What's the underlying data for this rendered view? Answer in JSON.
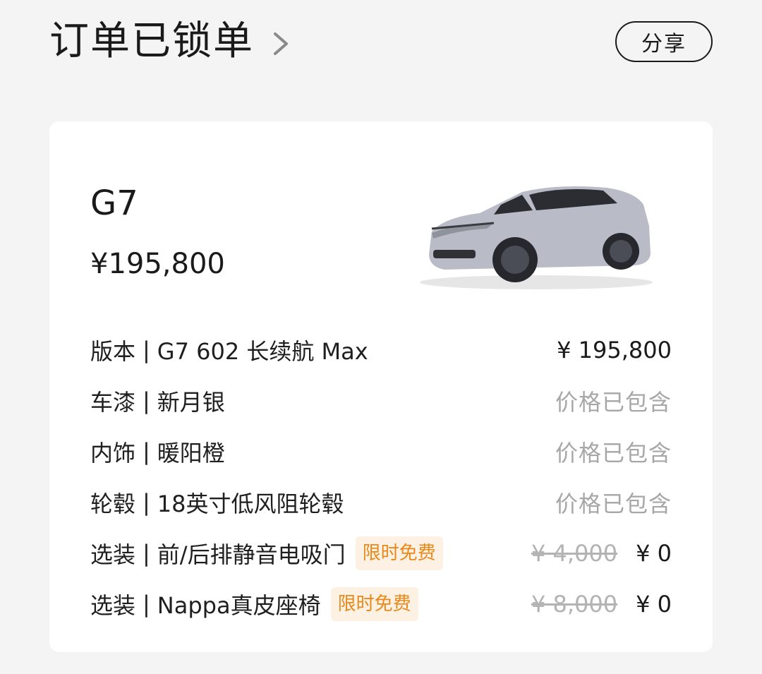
{
  "header": {
    "title": "订单已锁单",
    "share_label": "分享"
  },
  "card": {
    "model": "G7",
    "price": "¥195,800",
    "rows": [
      {
        "label": "版本",
        "sep": "|",
        "value": "G7 602 长续航 Max",
        "price": "¥ 195,800"
      },
      {
        "label": "车漆",
        "sep": "|",
        "value": "新月银",
        "included": "价格已包含"
      },
      {
        "label": "内饰",
        "sep": "|",
        "value": "暖阳橙",
        "included": "价格已包含"
      },
      {
        "label": "轮毂",
        "sep": "|",
        "value": "18英寸低风阻轮毂",
        "included": "价格已包含"
      },
      {
        "label": "选装",
        "sep": "|",
        "value": "前/后排静音电吸门",
        "badge": "限时免费",
        "old_price": "¥ 4,000",
        "price": "¥ 0"
      },
      {
        "label": "选装",
        "sep": "|",
        "value": "Nappa真皮座椅",
        "badge": "限时免费",
        "old_price": "¥ 8,000",
        "price": "¥ 0"
      }
    ]
  },
  "colors": {
    "background": "#f4f4f4",
    "card": "#ffffff",
    "badge_bg": "#fdf1e3",
    "badge_text": "#e8891c",
    "muted": "#a7a7a7"
  }
}
